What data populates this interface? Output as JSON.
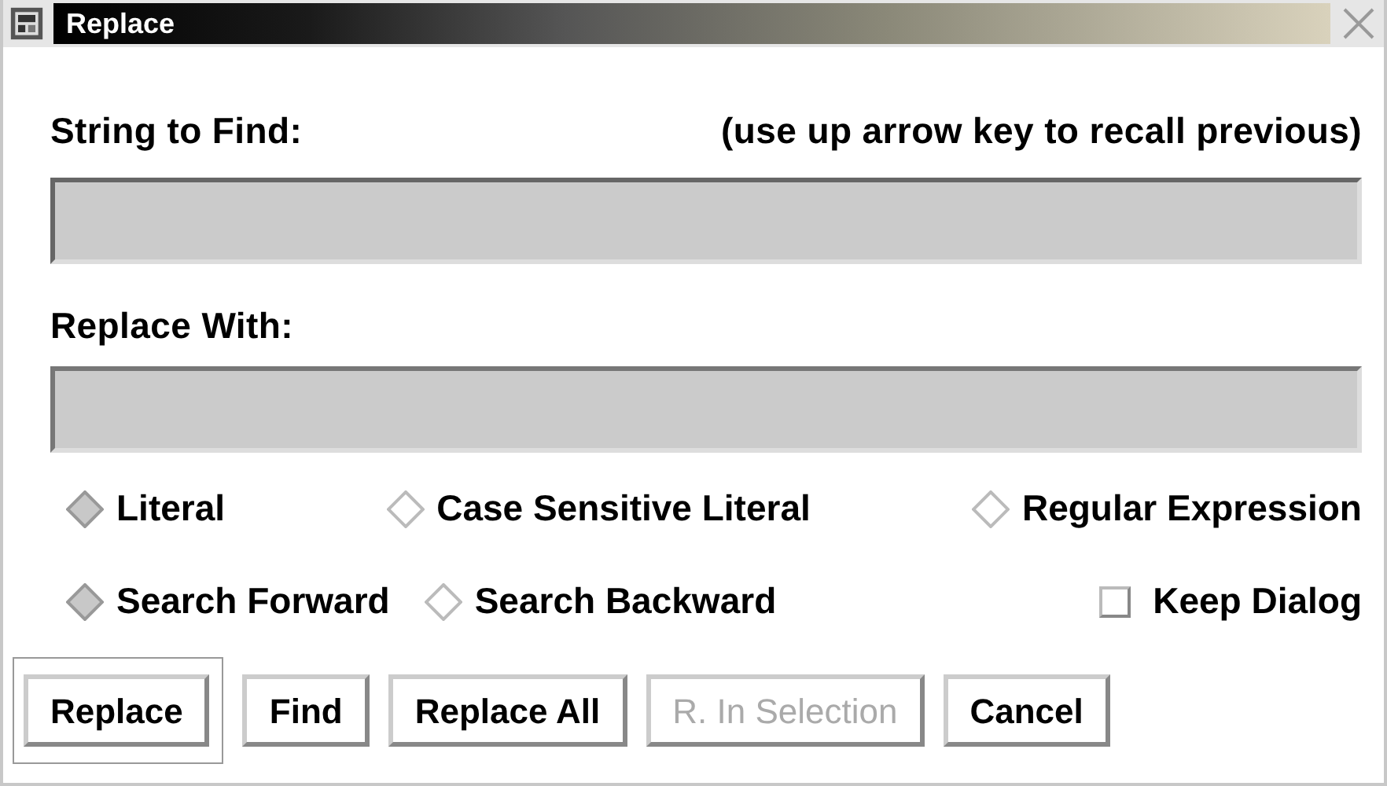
{
  "window": {
    "title": "Replace"
  },
  "find": {
    "label": "String to Find:",
    "hint": "(use up arrow key to recall previous)"
  },
  "replace": {
    "label": "Replace With:"
  },
  "match_options": [
    {
      "label": "Literal",
      "selected": true
    },
    {
      "label": "Case Sensitive Literal",
      "selected": false
    },
    {
      "label": "Regular Expression",
      "selected": false
    }
  ],
  "direction_options": [
    {
      "label": "Search Forward",
      "selected": true
    },
    {
      "label": "Search Backward",
      "selected": false
    }
  ],
  "keep_dialog": {
    "label": "Keep Dialog",
    "checked": false
  },
  "buttons": [
    {
      "label": "Replace",
      "default": true,
      "disabled": false
    },
    {
      "label": "Find",
      "default": false,
      "disabled": false
    },
    {
      "label": "Replace All",
      "default": false,
      "disabled": false
    },
    {
      "label": "R. In Selection",
      "default": false,
      "disabled": true
    },
    {
      "label": "Cancel",
      "default": false,
      "disabled": false
    }
  ]
}
